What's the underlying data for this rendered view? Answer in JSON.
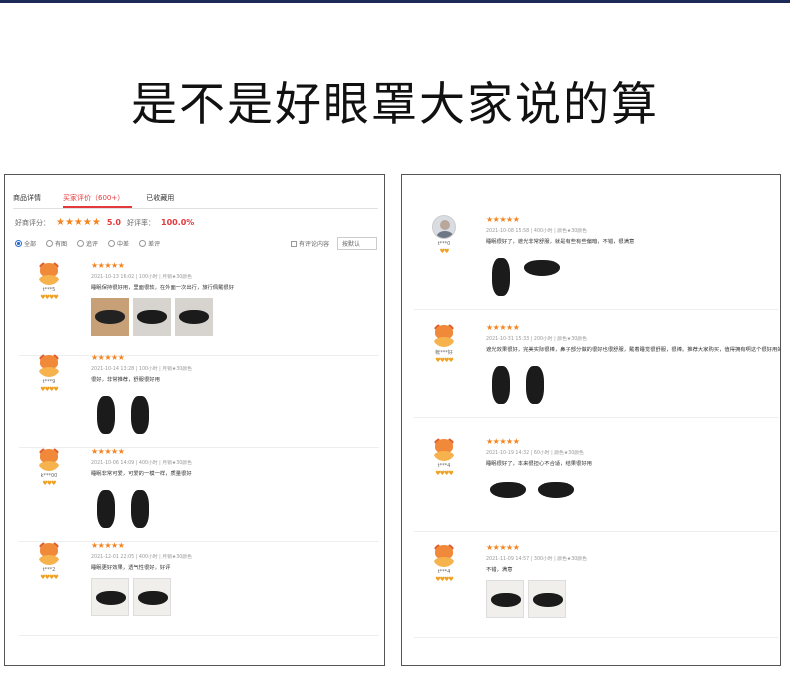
{
  "headline": "是不是好眼罩大家说的算",
  "left_panel": {
    "tabs": [
      "商品详情",
      "买家评价（600+）",
      "已收藏用"
    ],
    "rating": {
      "label": "好商评分：",
      "stars": "★★★★★",
      "score": "5.0",
      "rate_label": "好评率：",
      "rate": "100.0%"
    },
    "filters": [
      "全部",
      "有图",
      "追评",
      "中差",
      "差评"
    ],
    "filter_right": {
      "checkbox_label": "有评论内容",
      "select_value": "按默认"
    },
    "reviews": [
      {
        "user": "t***5",
        "level": "♥♥♥♥",
        "stars": "★★★★★",
        "meta": "2021-10-13 16:02  |  100小时  |  月销★30颜色",
        "text": "睡眠保持很好用，里面很软，在外面一次出行，旅行佩戴很好",
        "thumbs": [
          "wood",
          "gray",
          "gray"
        ]
      },
      {
        "user": "t***9",
        "level": "♥♥♥♥",
        "stars": "★★★★★",
        "meta": "2021-10-14 13:28  |  100小时  |  月销★30颜色",
        "text": "很好，非常推荐，舒服很好用",
        "thumbs": [
          "tall",
          "tall"
        ]
      },
      {
        "user": "k***00",
        "level": "♥♥♥",
        "stars": "★★★★★",
        "meta": "2021-10-06 14:09  |  400小时  |  月销★30颜色",
        "text": "睡眠非常可爱，可爱的一模一样，质量很好",
        "thumbs": [
          "tall",
          "tall"
        ]
      },
      {
        "user": "t***2",
        "level": "♥♥♥♥",
        "stars": "★★★★★",
        "meta": "2021-12-01 22:05  |  400小时  |  月销★30颜色",
        "text": "睡眠更好效果，透气性很好，好评",
        "thumbs": [
          "white",
          "white"
        ]
      }
    ]
  },
  "right_panel": {
    "reviews": [
      {
        "user": "t***0",
        "level": "♥♥",
        "avatar": "photo",
        "stars": "★★★★★",
        "meta": "2021-10-08 15:58  |  400小时  |  颜色★30颜色",
        "text": "睡眠很好了，遮光非常舒服，就是有些有些偏暗，不错，很满意",
        "thumbs": [
          "tall",
          "wide"
        ]
      },
      {
        "user": "帐***好",
        "level": "♥♥♥♥",
        "avatar": "cartoon",
        "stars": "★★★★★",
        "meta": "2021-10-31 15:33  |  200小时  |  颜色★30颜色",
        "text": "遮光效果很好，完美实际很棒，鼻子部分做的很好也很舒服，戴着睡觉很舒服，很棒。推荐大家购买，值得拥有啊这个很好用的，舒服不勒",
        "thumbs": [
          "tall",
          "tall"
        ]
      },
      {
        "user": "t***4",
        "level": "♥♥♥♥",
        "avatar": "cartoon",
        "stars": "★★★★★",
        "meta": "2021-10-19 14:32  |  60小时  |  颜色★30颜色",
        "text": "睡眠很好了，本来很担心不合适，结果很好用",
        "thumbs": [
          "wide",
          "wide"
        ]
      },
      {
        "user": "t***4",
        "level": "♥♥♥♥",
        "avatar": "cartoon",
        "stars": "★★★★★",
        "meta": "2021-11-09 14:57  |  300小时  |  颜色★30颜色",
        "text": "不错，满意",
        "thumbs": [
          "white",
          "white"
        ]
      }
    ]
  }
}
